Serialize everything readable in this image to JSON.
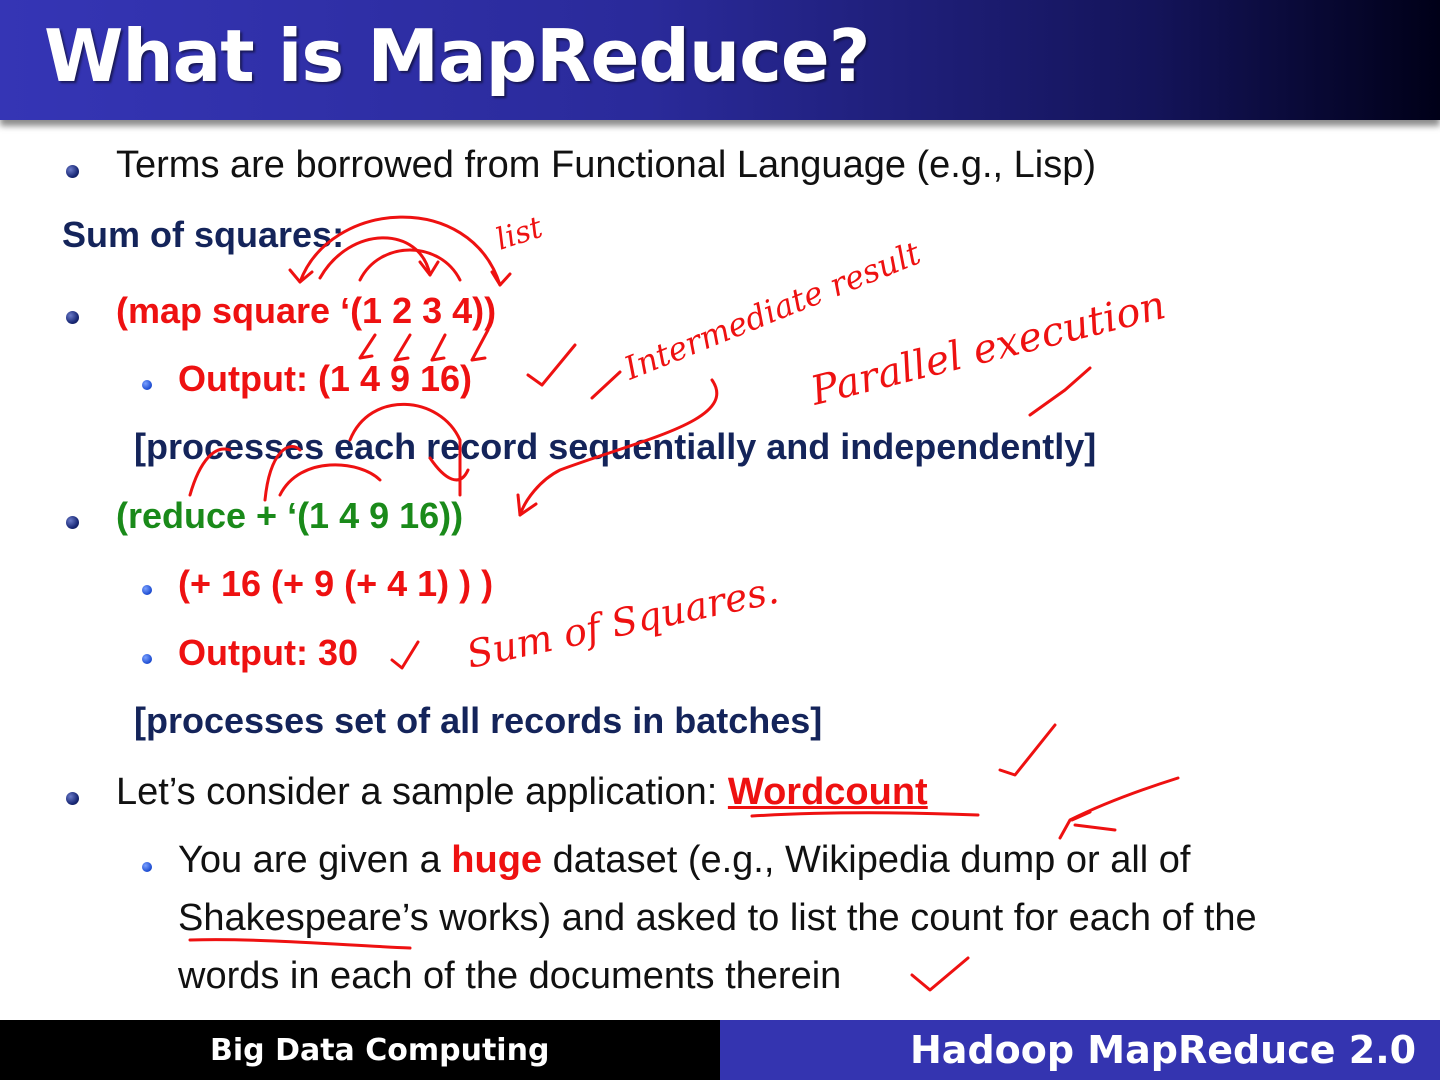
{
  "slide": {
    "title": "What is MapReduce?",
    "bullets": {
      "terms": "Terms are borrowed from Functional Language (e.g., Lisp)",
      "sum_heading": "Sum of squares:",
      "map_expr": "(map square ‘(1 2 3 4))",
      "map_output": "Output: (1 4 9 16)",
      "map_note": "[processes each record sequentially and independently]",
      "reduce_expr": "(reduce + ‘(1 4 9 16))",
      "reduce_nested": "(+ 16 (+ 9 (+ 4 1) ) )",
      "reduce_output": "Output: 30",
      "reduce_note": "[processes set of all records in batches]",
      "consider_prefix": "Let’s consider a sample application: ",
      "consider_highlight": "Wordcount",
      "given_prefix": "You are given a ",
      "given_highlight": "huge",
      "given_line1_rest": " dataset (e.g., Wikipedia dump or all of",
      "given_line2": "Shakespeare’s works) and asked to list the count for each of the",
      "given_line3": "words in each of the documents therein"
    },
    "annotations": {
      "list": "list",
      "intermediate": "Intermediate result",
      "parallel": "Parallel execution",
      "sum_squares": "Sum of Squares."
    }
  },
  "footer": {
    "left": "Big Data Computing",
    "right": "Hadoop MapReduce 2.0"
  },
  "colors": {
    "title_bar_start": "#3535b5",
    "title_bar_end": "#000018",
    "red_text": "#ee1111",
    "green_text": "#1a8a1a",
    "navy_text": "#14245a",
    "footer_right_bg": "#3434b0",
    "ink": "#ee1111"
  }
}
